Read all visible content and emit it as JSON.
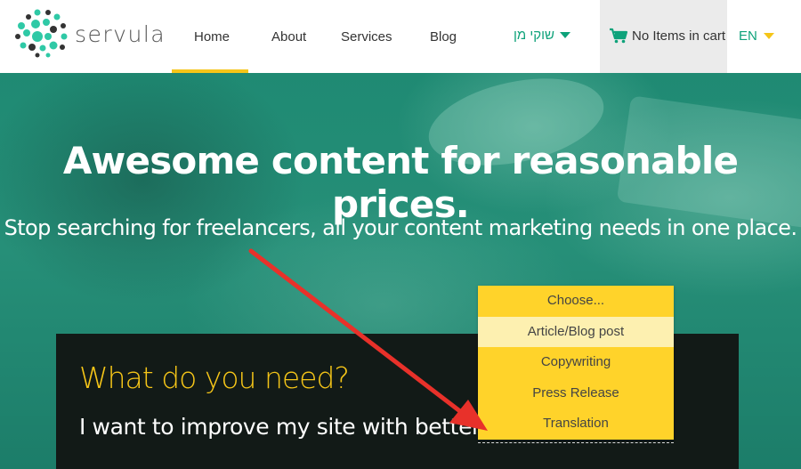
{
  "brand": {
    "name": "servula"
  },
  "nav": {
    "items": [
      {
        "label": "Home",
        "active": true
      },
      {
        "label": "About"
      },
      {
        "label": "Services"
      },
      {
        "label": "Blog"
      }
    ],
    "user_menu": "שוקי מן",
    "cart": {
      "label": "No Items in cart",
      "icon": "cart-icon"
    },
    "language": "EN"
  },
  "hero": {
    "title": "Awesome content for reasonable prices.",
    "subtitle": "Stop searching for freelancers, all your content marketing needs in one place."
  },
  "card": {
    "title": "What do you need?",
    "text": "I want to improve my site with better"
  },
  "dropdown": {
    "options": [
      "Choose...",
      "Article/Blog post",
      "Copywriting",
      "Press Release",
      "Translation"
    ],
    "highlighted_index": 1
  },
  "colors": {
    "accent_green": "#0ea27a",
    "accent_yellow": "#f5c518",
    "dropdown_bg": "#ffd32a",
    "arrow_red": "#e8312a"
  }
}
